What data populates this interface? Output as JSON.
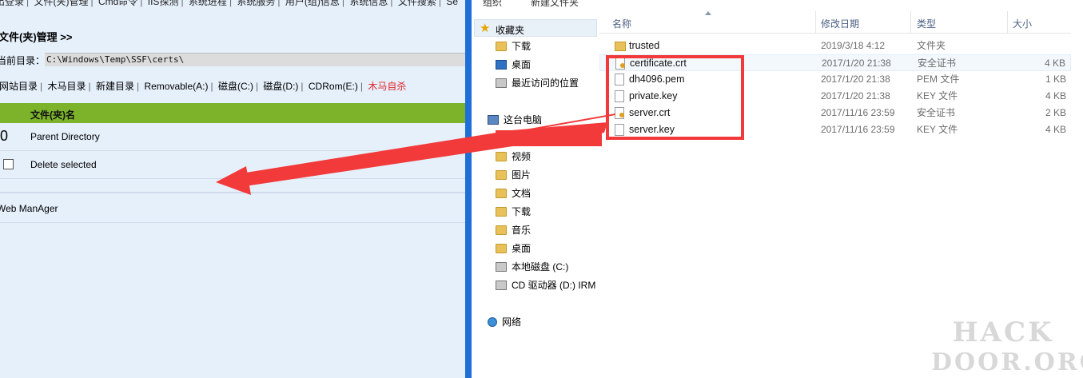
{
  "left_panel": {
    "top_nav": [
      "出登录",
      "文件(夹)管理",
      "Cmd命令",
      "IIS探测",
      "系统进程",
      "系统服务",
      "用户(组)信息",
      "系统信息",
      "文件搜索",
      "Se"
    ],
    "title": "文件(夹)管理 >>",
    "current_dir_label": "当前目录：",
    "current_dir_value": "C:\\Windows\\Temp\\SSF\\certs\\",
    "drive_links": [
      "网站目录",
      "木马目录",
      "新建目录",
      "Removable(A:)",
      "磁盘(C:)",
      "磁盘(D:)",
      "CDRom(E:)"
    ],
    "drive_link_red": "木马自杀",
    "table_header": "文件(夹)名",
    "parent_count": "0",
    "parent_label": "Parent Directory",
    "delete_label": "Delete selected",
    "footer": "Web ManAger",
    "accent_color": "#7cb32b"
  },
  "explorer": {
    "toolbar": [
      "组织",
      "新建文件夹"
    ],
    "favorites_label": "收藏夹",
    "nav_favorites": [
      "下载",
      "桌面",
      "最近访问的位置"
    ],
    "this_pc_label": "这台电脑",
    "nav_pc": [
      "视频",
      "图片",
      "文档",
      "下载",
      "音乐",
      "桌面",
      "本地磁盘 (C:)",
      "CD 驱动器 (D:) IRM"
    ],
    "network_label": "网络",
    "columns": {
      "name": "名称",
      "date": "修改日期",
      "type": "类型",
      "size": "大小"
    },
    "files": [
      {
        "icon": "folder-icon",
        "name": "trusted",
        "date": "2019/3/18 4:12",
        "type": "文件夹",
        "size": ""
      },
      {
        "icon": "certificate-icon",
        "name": "certificate.crt",
        "date": "2017/1/20 21:38",
        "type": "安全证书",
        "size": "4 KB"
      },
      {
        "icon": "file-icon",
        "name": "dh4096.pem",
        "date": "2017/1/20 21:38",
        "type": "PEM 文件",
        "size": "1 KB"
      },
      {
        "icon": "file-icon",
        "name": "private.key",
        "date": "2017/1/20 21:38",
        "type": "KEY 文件",
        "size": "4 KB"
      },
      {
        "icon": "certificate-icon",
        "name": "server.crt",
        "date": "2017/11/16 23:59",
        "type": "安全证书",
        "size": "2 KB"
      },
      {
        "icon": "file-icon",
        "name": "server.key",
        "date": "2017/11/16 23:59",
        "type": "KEY 文件",
        "size": "4 KB"
      }
    ]
  },
  "annotation_color": "#f23a3a",
  "watermark": {
    "line1": "HACK",
    "line2": "DOOR.ORG"
  }
}
